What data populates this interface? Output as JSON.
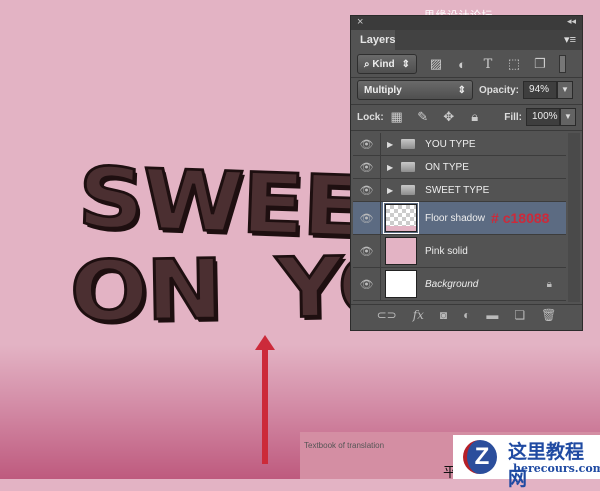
{
  "watermark_top": "思缘设计论坛  WWW.MISSYUAN.COM",
  "artwork": {
    "line1": "SWEET",
    "line2a": "ON",
    "line2b": "YOU"
  },
  "panel": {
    "close": "×",
    "collapse": "◂◂",
    "tab": "Layers",
    "menu": "▾≡",
    "filter": {
      "label": "Kind"
    },
    "blend_mode": "Multiply",
    "opacity_label": "Opacity:",
    "opacity": "94%",
    "lock_label": "Lock:",
    "fill_label": "Fill:",
    "fill": "100%",
    "layers": [
      {
        "name": "YOU TYPE",
        "type": "group"
      },
      {
        "name": "ON TYPE",
        "type": "group"
      },
      {
        "name": "SWEET TYPE",
        "type": "group"
      },
      {
        "name": "Floor shadow",
        "type": "layer",
        "annotation": "# c18088",
        "selected": true
      },
      {
        "name": "Pink solid",
        "type": "layer",
        "color": "#e3b3c4"
      },
      {
        "name": "Background",
        "type": "layer",
        "locked": true,
        "color": "#ffffff"
      }
    ],
    "bottom": {
      "fx": "fx"
    }
  },
  "footer": {
    "textbook": "Textbook of translation",
    "char": "平"
  },
  "logo": {
    "letter": "Z",
    "cn": "这里教程网",
    "en": "herecours.com"
  }
}
